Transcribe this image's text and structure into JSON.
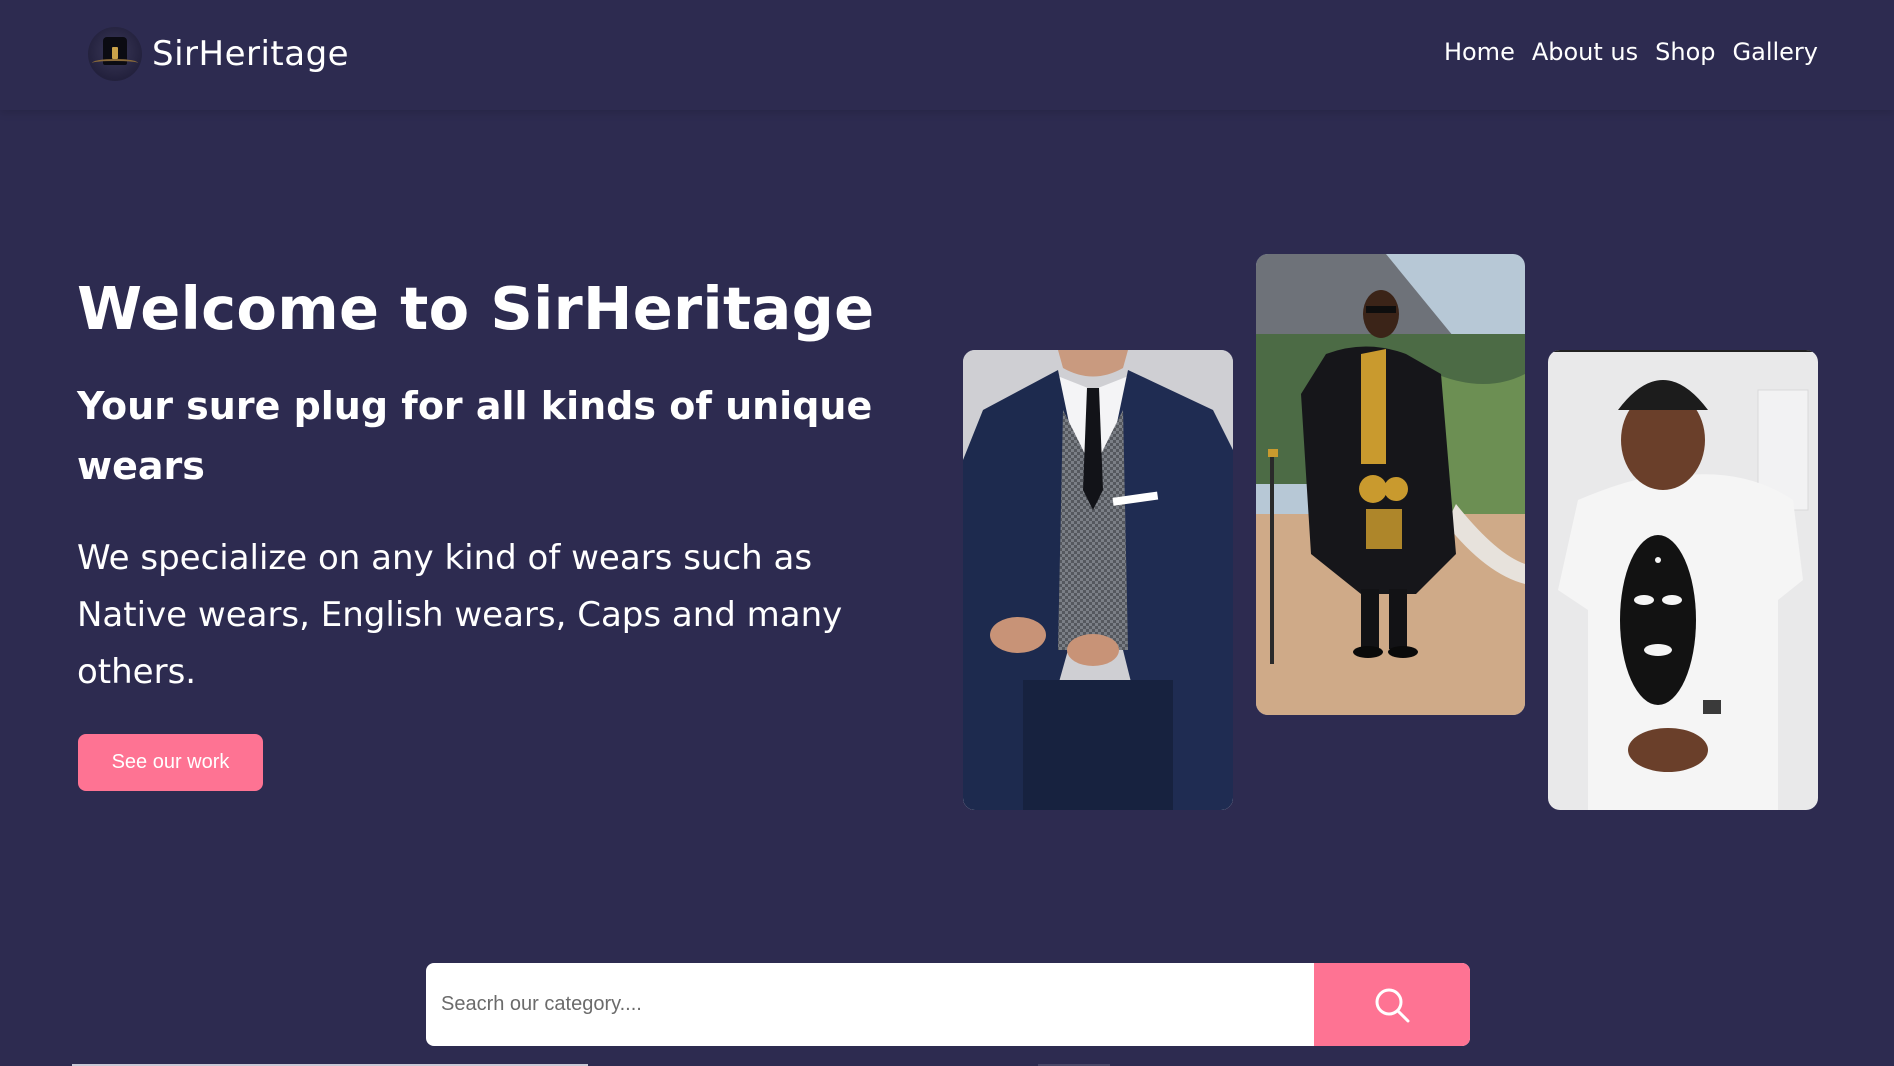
{
  "header": {
    "brand_name": "SirHeritage",
    "logo_icon": "heritage-logo-icon",
    "nav": [
      {
        "label": "Home"
      },
      {
        "label": "About us"
      },
      {
        "label": "Shop"
      },
      {
        "label": "Gallery"
      }
    ]
  },
  "hero": {
    "title": "Welcome to SirHeritage",
    "subtitle": "Your sure plug for all kinds of unique wears",
    "description": "We specialize on any kind of wears such as Native wears, English wears, Caps and many others.",
    "cta_label": "See our work"
  },
  "gallery": [
    {
      "subject": "man in navy suit"
    },
    {
      "subject": "man in black and gold agbada"
    },
    {
      "subject": "man in white native shirt with mask print"
    }
  ],
  "search": {
    "placeholder": "Seacrh our category....",
    "button_icon": "search-icon"
  },
  "colors": {
    "background": "#2d2b50",
    "accent": "#fe7393",
    "text": "#ffffff"
  }
}
